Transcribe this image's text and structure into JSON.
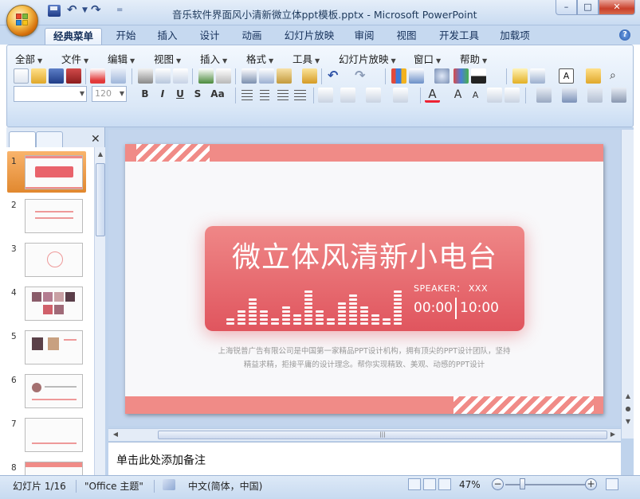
{
  "window": {
    "title": "音乐软件界面风小清新微立体ppt模板.pptx - Microsoft PowerPoint",
    "minimize": "–",
    "maximize": "□",
    "close": "✕"
  },
  "quick_access": {
    "undo": "↶",
    "redo": "↷",
    "more": "="
  },
  "tabs": [
    "经典菜单",
    "开始",
    "插入",
    "设计",
    "动画",
    "幻灯片放映",
    "审阅",
    "视图",
    "开发工具",
    "加载项"
  ],
  "active_tab": "经典菜单",
  "help_label": "?",
  "menus": [
    "全部",
    "文件",
    "编辑",
    "视图",
    "插入",
    "格式",
    "工具",
    "幻灯片放映",
    "窗口",
    "帮助"
  ],
  "font_combo": {
    "font": "",
    "size": "120"
  },
  "format_buttons": [
    "B",
    "I",
    "U",
    "S",
    "Aa"
  ],
  "thumb_pane": {
    "close_label": "✕",
    "slides": [
      {
        "number": "1"
      },
      {
        "number": "2"
      },
      {
        "number": "3"
      },
      {
        "number": "4"
      },
      {
        "number": "5"
      },
      {
        "number": "6"
      },
      {
        "number": "7"
      },
      {
        "number": "8"
      }
    ]
  },
  "slide": {
    "title": "微立体风清新小电台",
    "speaker": "SPEAKER：  XXX",
    "time_start": "00:00",
    "time_end": "10:00",
    "desc_line1": "上海锐普广告有限公司是中国第一家精品PPT设计机构，拥有顶尖的PPT设计团队，坚持",
    "desc_line2": "精益求精，拒接平庸的设计理念。帮你实现精致、美观、动感的PPT设计",
    "accent_color": "#f08b87"
  },
  "notes_placeholder": "单击此处添加备注",
  "statusbar": {
    "slide_info": "幻灯片 1/16",
    "theme": "\"Office 主题\"",
    "language": "中文(简体，中国)",
    "zoom": "47%",
    "zoom_out": "−",
    "zoom_in": "+"
  }
}
